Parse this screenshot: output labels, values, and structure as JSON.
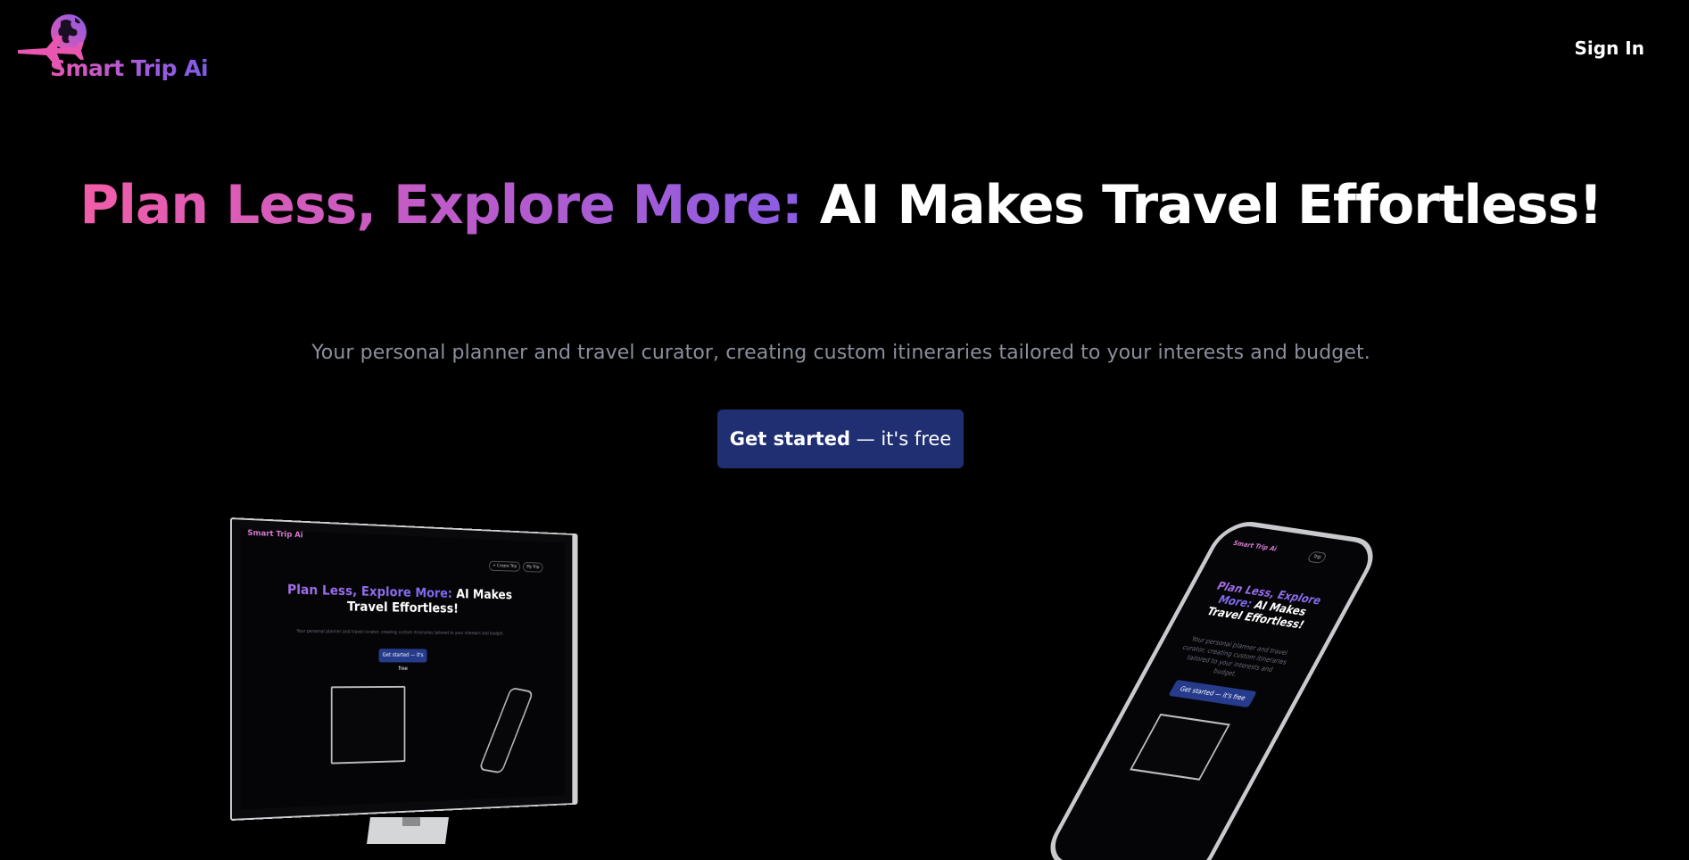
{
  "header": {
    "logo_text": "Smart Trip Ai",
    "sign_in": "Sign In"
  },
  "hero": {
    "title_gradient": "Plan Less, Explore More:",
    "title_plain": "AI Makes Travel Effortless!",
    "subtitle": "Your personal planner and travel curator, creating custom itineraries tailored to your interests and budget.",
    "cta_strong": "Get started",
    "cta_light": "— it's free"
  },
  "monitor_preview": {
    "logo_text": "Smart Trip Ai",
    "nav_create": "+ Create Trip",
    "nav_my": "My Trip",
    "title_gradient": "Plan Less, Explore More:",
    "title_plain": "AI Makes Travel Effortless!",
    "subtitle": "Your personal planner and travel curator, creating custom itineraries tailored to your interests and budget.",
    "cta": "Get started — it's free"
  },
  "phone_preview": {
    "logo_text": "Smart Trip Ai",
    "nav_my": "Trip",
    "title_gradient": "Plan Less, Explore More:",
    "title_plain": "AI Makes Travel Effortless!",
    "subtitle": "Your personal planner and travel curator, creating custom itineraries tailored to your interests and budget.",
    "cta": "Get started — it's free"
  },
  "colors": {
    "background": "#000000",
    "cta_bg": "#1f2f72",
    "gradient_start": "#f15da8",
    "gradient_end": "#8a5ce2",
    "subtitle": "#8b8f9c"
  }
}
